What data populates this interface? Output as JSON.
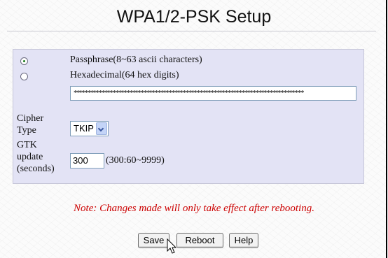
{
  "page": {
    "title": "WPA1/2-PSK Setup"
  },
  "key_format": {
    "options": [
      {
        "label": "Passphrase(8~63 ascii characters)",
        "selected": true
      },
      {
        "label": "Hexadecimal(64 hex digits)",
        "selected": false
      }
    ],
    "key_value": "**********************************************************************************"
  },
  "cipher": {
    "label_line1": "Cipher",
    "label_line2": "Type",
    "selected": "TKIP"
  },
  "gtk": {
    "label_line1": "GTK",
    "label_line2": "update",
    "label_line3": "(seconds)",
    "value": "300",
    "hint": "(300:60~9999)"
  },
  "note": "Note: Changes made will only take effect after rebooting.",
  "buttons": {
    "save": "Save",
    "reboot": "Reboot",
    "help": "Help"
  }
}
